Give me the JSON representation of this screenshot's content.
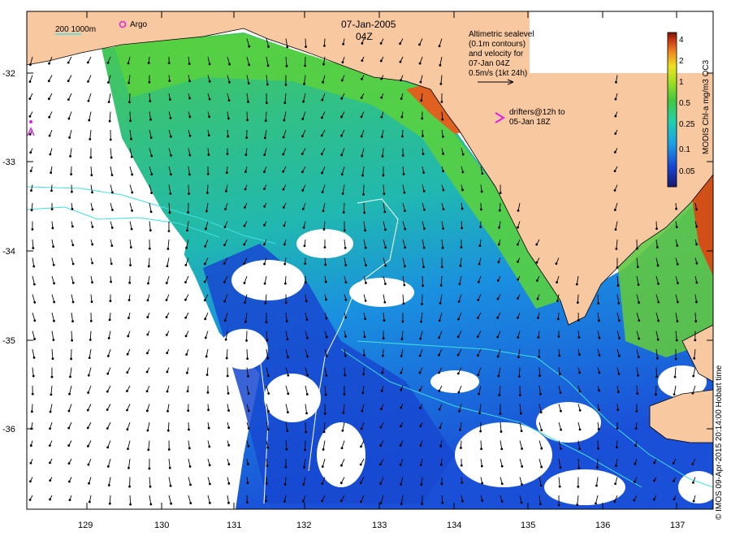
{
  "map": {
    "date": "07-Jan-2005",
    "time": "04Z",
    "legend_isobaths": "200  1000m",
    "legend_argo": "Argo",
    "sealevel_note": [
      "Altimetric sealevel",
      "(0.1m contours)",
      "and velocity for",
      "07-Jan 04Z",
      "0.5m/s (1kt 24h)"
    ],
    "drifters_note": [
      "drifters@12h to",
      "05-Jan 18Z"
    ],
    "colorbar_title": "MODIS Chl-a mg/m3 OC3",
    "colorbar_ticks": [
      "4",
      "2",
      "1",
      "0.5",
      "0.25",
      "0.1",
      "0.05"
    ],
    "credit": "© IMOS 09-Apr-2015 20:14:00 Hobart time",
    "lat_labels": [
      "-32",
      "-33",
      "-34",
      "-35",
      "-36"
    ],
    "lon_labels": [
      "129",
      "130",
      "131",
      "132",
      "133",
      "134",
      "135",
      "136",
      "137"
    ],
    "colors": {
      "land": "#f8c8a0",
      "isobath": "#40e0e0",
      "argo": "#e020e0",
      "chl_high": "#8b2a10",
      "chl_mid": "#80d020",
      "chl_low": "#1a4fd0",
      "arrow": "#000000"
    }
  }
}
